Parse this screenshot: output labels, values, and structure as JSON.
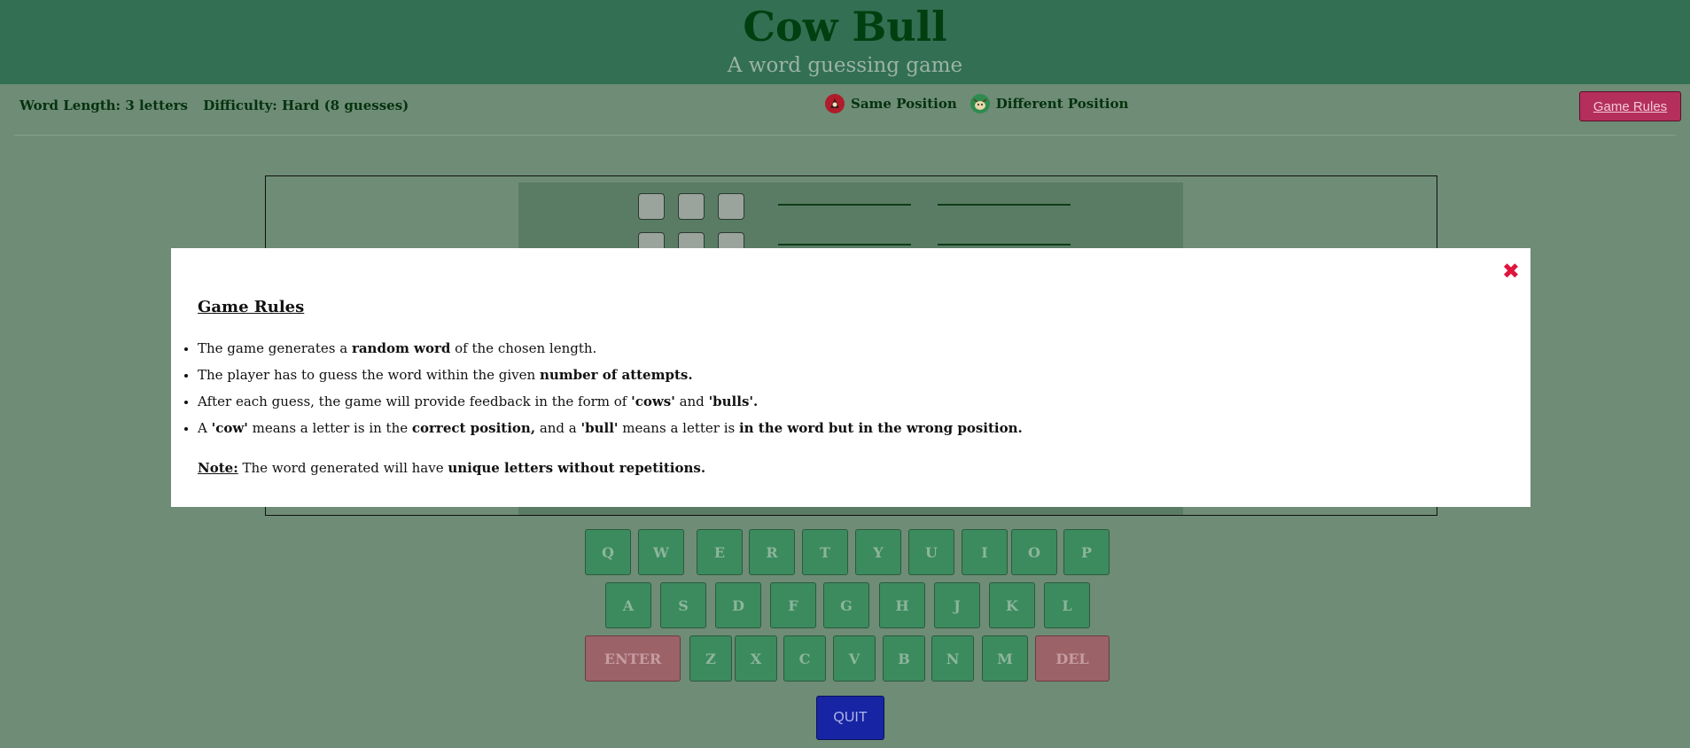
{
  "header": {
    "title": "Cow Bull",
    "subtitle": "A word guessing game"
  },
  "info": {
    "word_length": "Word Length: 3 letters",
    "difficulty": "Difficulty: Hard (8 guesses)"
  },
  "legend": {
    "same_label": "Same Position",
    "different_label": "Different Position",
    "same_icon": "cow-icon",
    "different_icon": "bull-icon"
  },
  "rules_button": "Game Rules",
  "keyboard": {
    "row1": [
      "Q",
      "W",
      "E",
      "R",
      "T",
      "Y",
      "U",
      "I",
      "O",
      "P"
    ],
    "row2": [
      "A",
      "S",
      "D",
      "F",
      "G",
      "H",
      "J",
      "K",
      "L"
    ],
    "row3": [
      "ENTER",
      "Z",
      "X",
      "C",
      "V",
      "B",
      "N",
      "M",
      "DEL"
    ]
  },
  "quit_label": "QUIT",
  "modal": {
    "close": "✖",
    "title": "Game Rules",
    "rules": [
      [
        {
          "t": "The game generates a ",
          "b": false
        },
        {
          "t": "random word",
          "b": true
        },
        {
          "t": " of the chosen length.",
          "b": false
        }
      ],
      [
        {
          "t": "The player has to guess the word within the given ",
          "b": false
        },
        {
          "t": "number of attempts.",
          "b": true
        }
      ],
      [
        {
          "t": "After each guess, the game will provide feedback in the form of ",
          "b": false
        },
        {
          "t": "'cows'",
          "b": true
        },
        {
          "t": " and ",
          "b": false
        },
        {
          "t": "'bulls'.",
          "b": true
        }
      ],
      [
        {
          "t": "A ",
          "b": false
        },
        {
          "t": "'cow'",
          "b": true
        },
        {
          "t": " means a letter is in the ",
          "b": false
        },
        {
          "t": "correct position,",
          "b": true
        },
        {
          "t": " and a ",
          "b": false
        },
        {
          "t": "'bull'",
          "b": true
        },
        {
          "t": " means a letter is ",
          "b": false
        },
        {
          "t": "in the word but in the wrong position.",
          "b": true
        }
      ]
    ],
    "note_label": "Note:",
    "note_text": " The word generated will have ",
    "note_bold": "unique letters without repetitions."
  },
  "colors": {
    "page_bg": "#6e8c76",
    "header_bg": "#326f53",
    "key_bg": "#3b8b5e",
    "action_key_bg": "#9b6268",
    "rules_btn_bg": "#b42f5c",
    "quit_bg": "#1724a3",
    "close_color": "#e0143c"
  }
}
